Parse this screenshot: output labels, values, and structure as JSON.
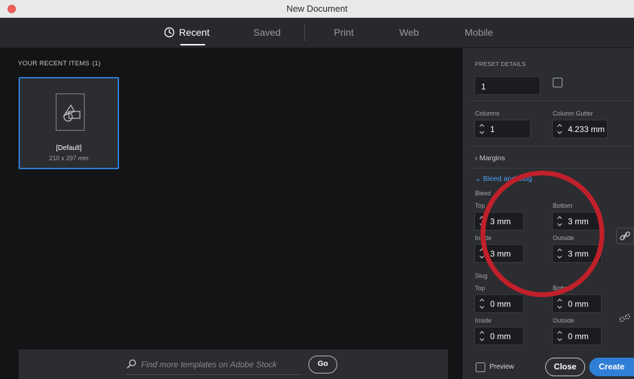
{
  "window": {
    "title": "New Document"
  },
  "tabs": [
    {
      "label": "Recent",
      "active": true
    },
    {
      "label": "Saved"
    },
    {
      "label": "Print"
    },
    {
      "label": "Web"
    },
    {
      "label": "Mobile"
    }
  ],
  "recent": {
    "heading": "YOUR RECENT ITEMS",
    "count": "(1)",
    "items": [
      {
        "name": "[Default]",
        "size": "210 x 297 mm"
      }
    ]
  },
  "search": {
    "placeholder": "Find more templates on Adobe Stock",
    "go_label": "Go"
  },
  "preset": {
    "heading": "PRESET DETAILS",
    "pages_value": "1",
    "columns_label": "Columns",
    "columns_value": "1",
    "gutter_label": "Column Gutter",
    "gutter_value": "4.233 mm",
    "margins_label": "Margins",
    "bleed_slug_label": "Bleed and Slug",
    "bleed": {
      "label": "Bleed",
      "top_label": "Top",
      "top": "3 mm",
      "bottom_label": "Bottom",
      "bottom": "3 mm",
      "inside_label": "Inside",
      "inside": "3 mm",
      "outside_label": "Outside",
      "outside": "3 mm"
    },
    "slug": {
      "label": "Slug",
      "top_label": "Top",
      "top": "0 mm",
      "bottom_label": "Bottom",
      "bottom": "0 mm",
      "inside_label": "Inside",
      "inside": "0 mm",
      "outside_label": "Outside",
      "outside": "0 mm"
    }
  },
  "footer": {
    "preview_label": "Preview",
    "close_label": "Close",
    "create_label": "Create"
  },
  "colors": {
    "accent": "#2f7fd6",
    "annotation": "#c0202a",
    "section_blue": "#4ea1f3"
  }
}
